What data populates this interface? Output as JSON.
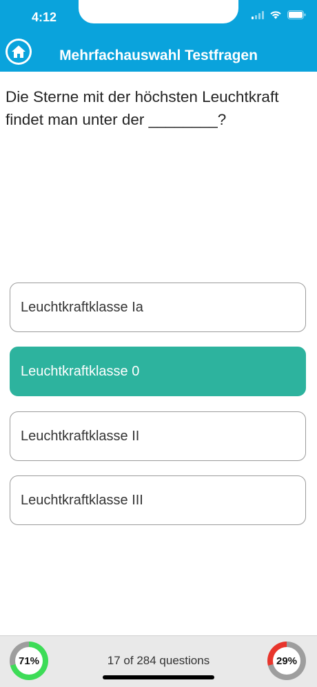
{
  "status_bar": {
    "time": "4:12",
    "icons": [
      "signal-icon",
      "wifi-icon",
      "battery-icon"
    ]
  },
  "header": {
    "title": "Mehrfachauswahl Testfragen",
    "home_icon": "home-icon",
    "background_color": "#0aa3dc"
  },
  "question": {
    "text": "Die Sterne mit der höchsten Leuchtkraft findet man unter der ________?"
  },
  "options": [
    {
      "label": "Leuchtkraftklasse Ia",
      "selected": false
    },
    {
      "label": "Leuchtkraftklasse 0",
      "selected": true
    },
    {
      "label": "Leuchtkraftklasse II",
      "selected": false
    },
    {
      "label": "Leuchtkraftklasse III",
      "selected": false
    }
  ],
  "footer": {
    "correct_percent_label": "71%",
    "correct_fraction": 0.71,
    "correct_color": "#3ddc57",
    "wrong_percent_label": "29%",
    "wrong_fraction": 0.29,
    "wrong_color": "#e8352c",
    "progress_text": "17 of 284 questions"
  },
  "colors": {
    "selected_option": "#2db39e",
    "ring_track": "#9e9e9e"
  }
}
